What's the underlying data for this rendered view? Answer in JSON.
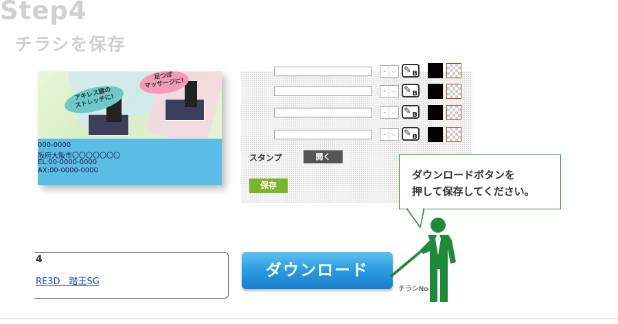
{
  "heading": {
    "step": "Step4",
    "subtitle": "チラシを保存"
  },
  "flyer": {
    "bubble_left": [
      "アキレス腱の",
      "ストレッチに!"
    ],
    "bubble_right": [
      "足つぼ",
      "マッサージに!"
    ],
    "info_lines": [
      "000-0000",
      "阪府大阪市〇〇〇〇〇〇〇",
      "EL:00-0000-0000",
      "AX:00-0000-0000"
    ]
  },
  "editor": {
    "rows": [
      {
        "text": "",
        "size": "-"
      },
      {
        "text": "",
        "size": "-"
      },
      {
        "text": "",
        "size": "-"
      },
      {
        "text": "",
        "size": "-"
      }
    ],
    "stamp_label": "スタンプ",
    "open_label": "開く",
    "save_label": "保存"
  },
  "callout": {
    "line1": "ダウンロードボタンを",
    "line2": "押して保存してください。"
  },
  "info_box": {
    "title": "4",
    "link": "RE3D　踏王SG"
  },
  "download": {
    "label": "ダウンロード"
  },
  "flyer_no_label": "チラシNo",
  "colors": {
    "accent_green": "#7db32b",
    "download_blue": "#2a9adf",
    "mascot_green": "#1f8a3b",
    "link_blue": "#1a3fa8"
  }
}
